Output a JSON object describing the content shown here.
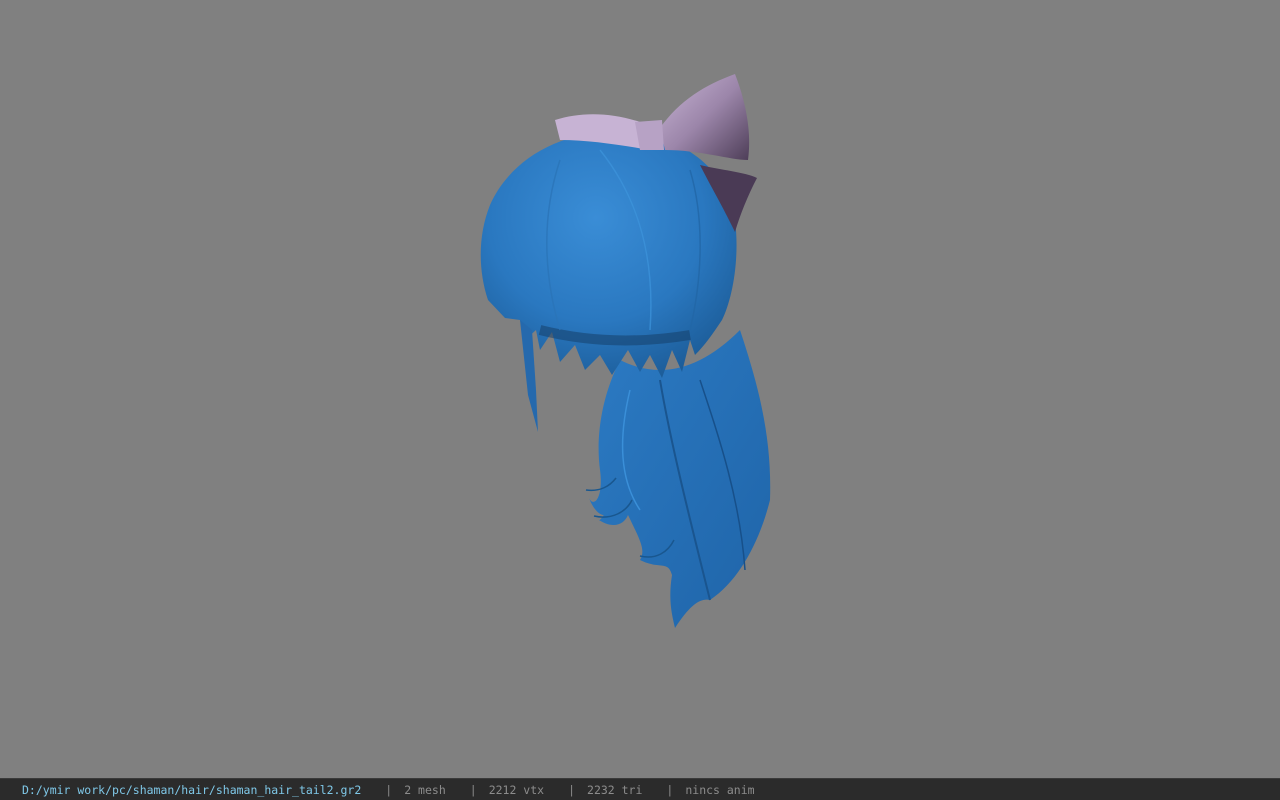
{
  "viewer": {
    "background_color": "#808080",
    "model_icon": "hair-model-icon",
    "hair_color": "#2f7fc6",
    "bow_color": "#9a86a8"
  },
  "statusbar": {
    "file_path": "D:/ymir work/pc/shaman/hair/shaman_hair_tail2.gr2",
    "separator": "|",
    "mesh_count": "2 mesh",
    "vertex_count": "2212 vtx",
    "triangle_count": "2232 tri",
    "anim_status": "nincs anim"
  }
}
